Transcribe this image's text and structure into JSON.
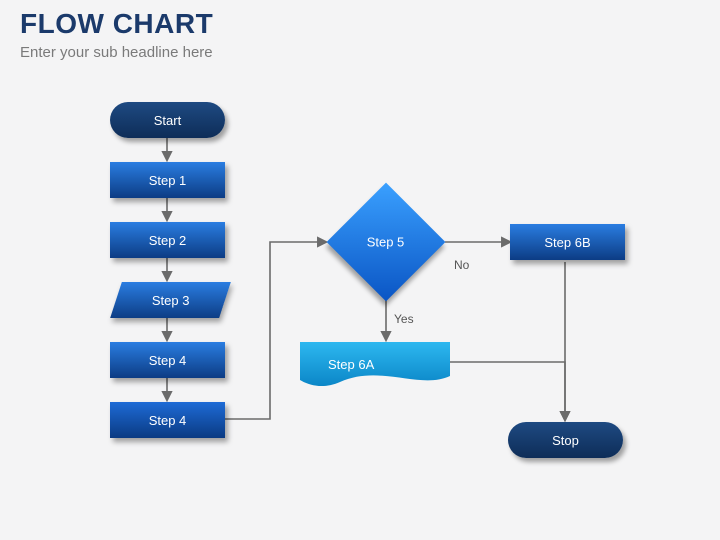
{
  "header": {
    "title": "FLOW CHART",
    "subtitle": "Enter your sub headline here"
  },
  "nodes": {
    "start": {
      "label": "Start"
    },
    "step1": {
      "label": "Step 1"
    },
    "step2": {
      "label": "Step 2"
    },
    "step3": {
      "label": "Step 3"
    },
    "step4": {
      "label": "Step 4"
    },
    "step5": {
      "label": "Step 5"
    },
    "step6a": {
      "label": "Step 6A"
    },
    "step6b": {
      "label": "Step 6B"
    },
    "stop": {
      "label": "Stop"
    }
  },
  "edges": {
    "decision_no": {
      "label": "No"
    },
    "decision_yes": {
      "label": "Yes"
    }
  }
}
